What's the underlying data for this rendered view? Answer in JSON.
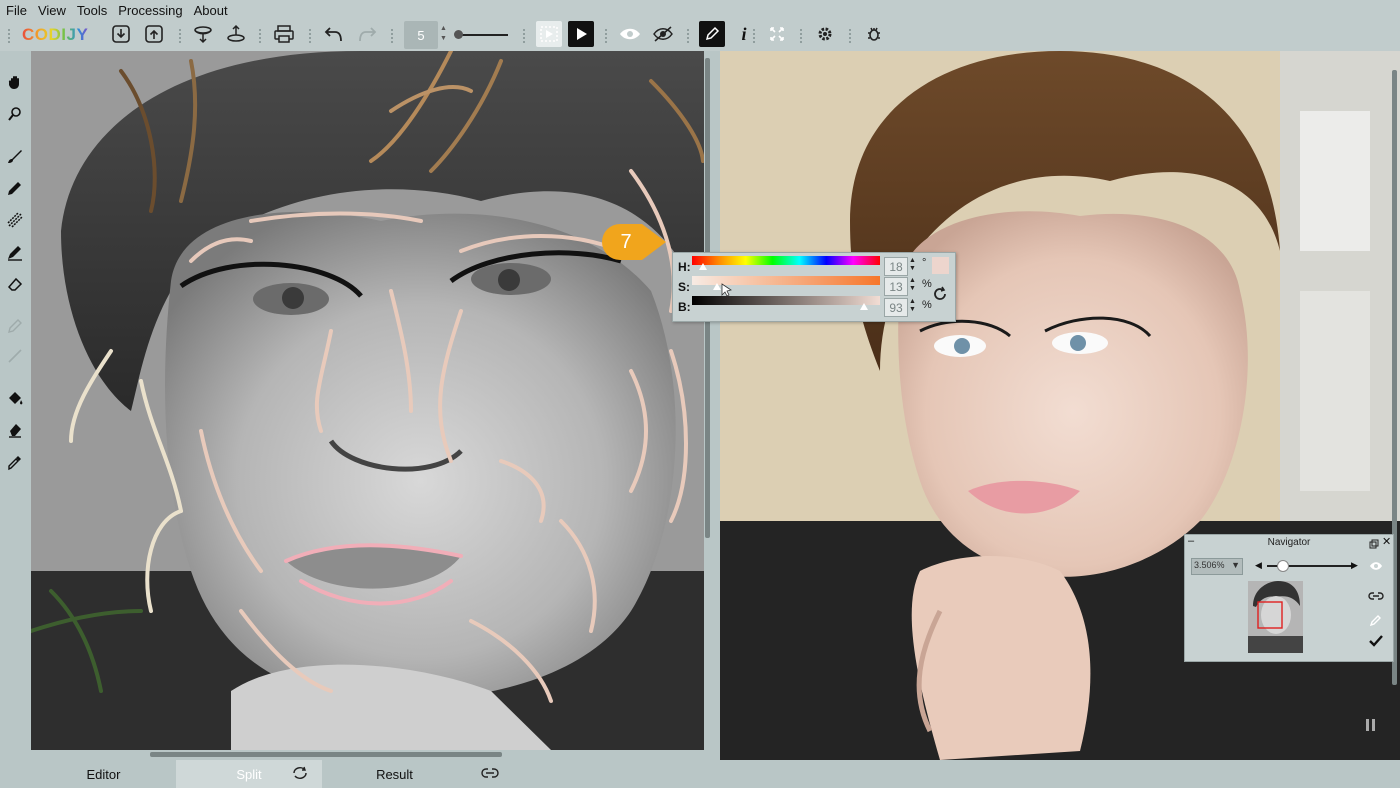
{
  "menu": [
    "File",
    "View",
    "Tools",
    "Processing",
    "About"
  ],
  "logo": {
    "text": "CODIJY"
  },
  "toolbar": {
    "brush_size": "5",
    "icons": [
      "import-icon",
      "export-icon",
      "save-project-icon",
      "open-project-icon",
      "print-icon",
      "undo-icon",
      "redo-icon",
      "brush-size-stepper",
      "preview-play-icon",
      "play-icon",
      "eye-icon",
      "hide-strokes-icon",
      "pen-icon",
      "info-icon",
      "fit-icon",
      "settings-icon",
      "bug-icon"
    ]
  },
  "left_tools": [
    "hand-icon",
    "zoom-icon",
    "brush-icon",
    "pencil-icon",
    "hatch-brush-icon",
    "marker-icon",
    "eraser-icon",
    "pen-disabled-icon",
    "line-disabled-icon",
    "fill-icon",
    "bucket-eraser-icon",
    "eyedropper-icon"
  ],
  "callout": {
    "number": "7",
    "color": "#f1a51c"
  },
  "color_panel": {
    "h_label": "H:",
    "h_value": "18",
    "h_unit": "°",
    "s_label": "S:",
    "s_value": "13",
    "s_unit": "%",
    "b_label": "B:",
    "b_value": "93",
    "b_unit": "%",
    "swatch_color": "#edd5cd"
  },
  "navigator": {
    "title": "Navigator",
    "zoom": "3.506%"
  },
  "bottom_tabs": {
    "editor": "Editor",
    "split": "Split",
    "result": "Result"
  },
  "colors": {
    "accent": "#f1a51c",
    "panel_bg": "#c8d2d2",
    "app_bg": "#b9c6c6"
  }
}
